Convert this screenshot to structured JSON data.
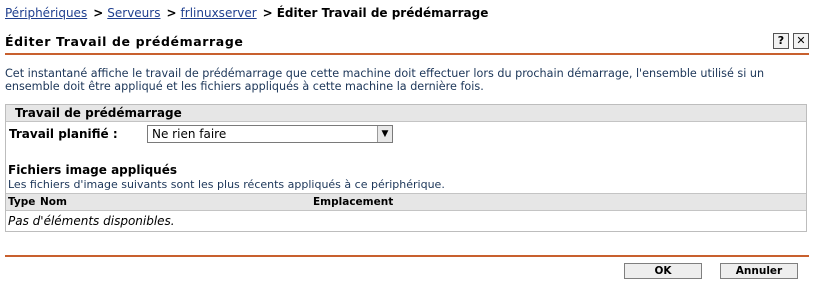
{
  "breadcrumb": {
    "items": [
      "Périphériques",
      "Serveurs",
      "frlinuxserver"
    ],
    "current": "Éditer Travail de prédémarrage",
    "separator": ">"
  },
  "page": {
    "title": "Éditer Travail de prédémarrage",
    "help_icon": "help-icon",
    "close_icon": "close-icon",
    "help_glyph": "?",
    "close_glyph": "✕"
  },
  "intro": {
    "text": "Cet instantané affiche le travail de prédémarrage que cette machine doit effectuer lors du prochain démarrage, l'ensemble utilisé si un ensemble doit être appliqué et les fichiers appliqués à cette machine la dernière fois."
  },
  "panel": {
    "header": "Travail de prédémarrage",
    "scheduled_label": "Travail planifié :",
    "scheduled_value": "Ne rien faire"
  },
  "images": {
    "title": "Fichiers image appliqués",
    "description": "Les fichiers d'image suivants sont les plus récents appliqués à ce périphérique.",
    "columns": [
      "Type",
      "Nom",
      "Emplacement"
    ],
    "empty_text": "Pas d'éléments disponibles."
  },
  "buttons": {
    "ok": "OK",
    "cancel": "Annuler"
  },
  "colors": {
    "accent_rule": "#c8602e",
    "link": "#1f3f8f"
  }
}
